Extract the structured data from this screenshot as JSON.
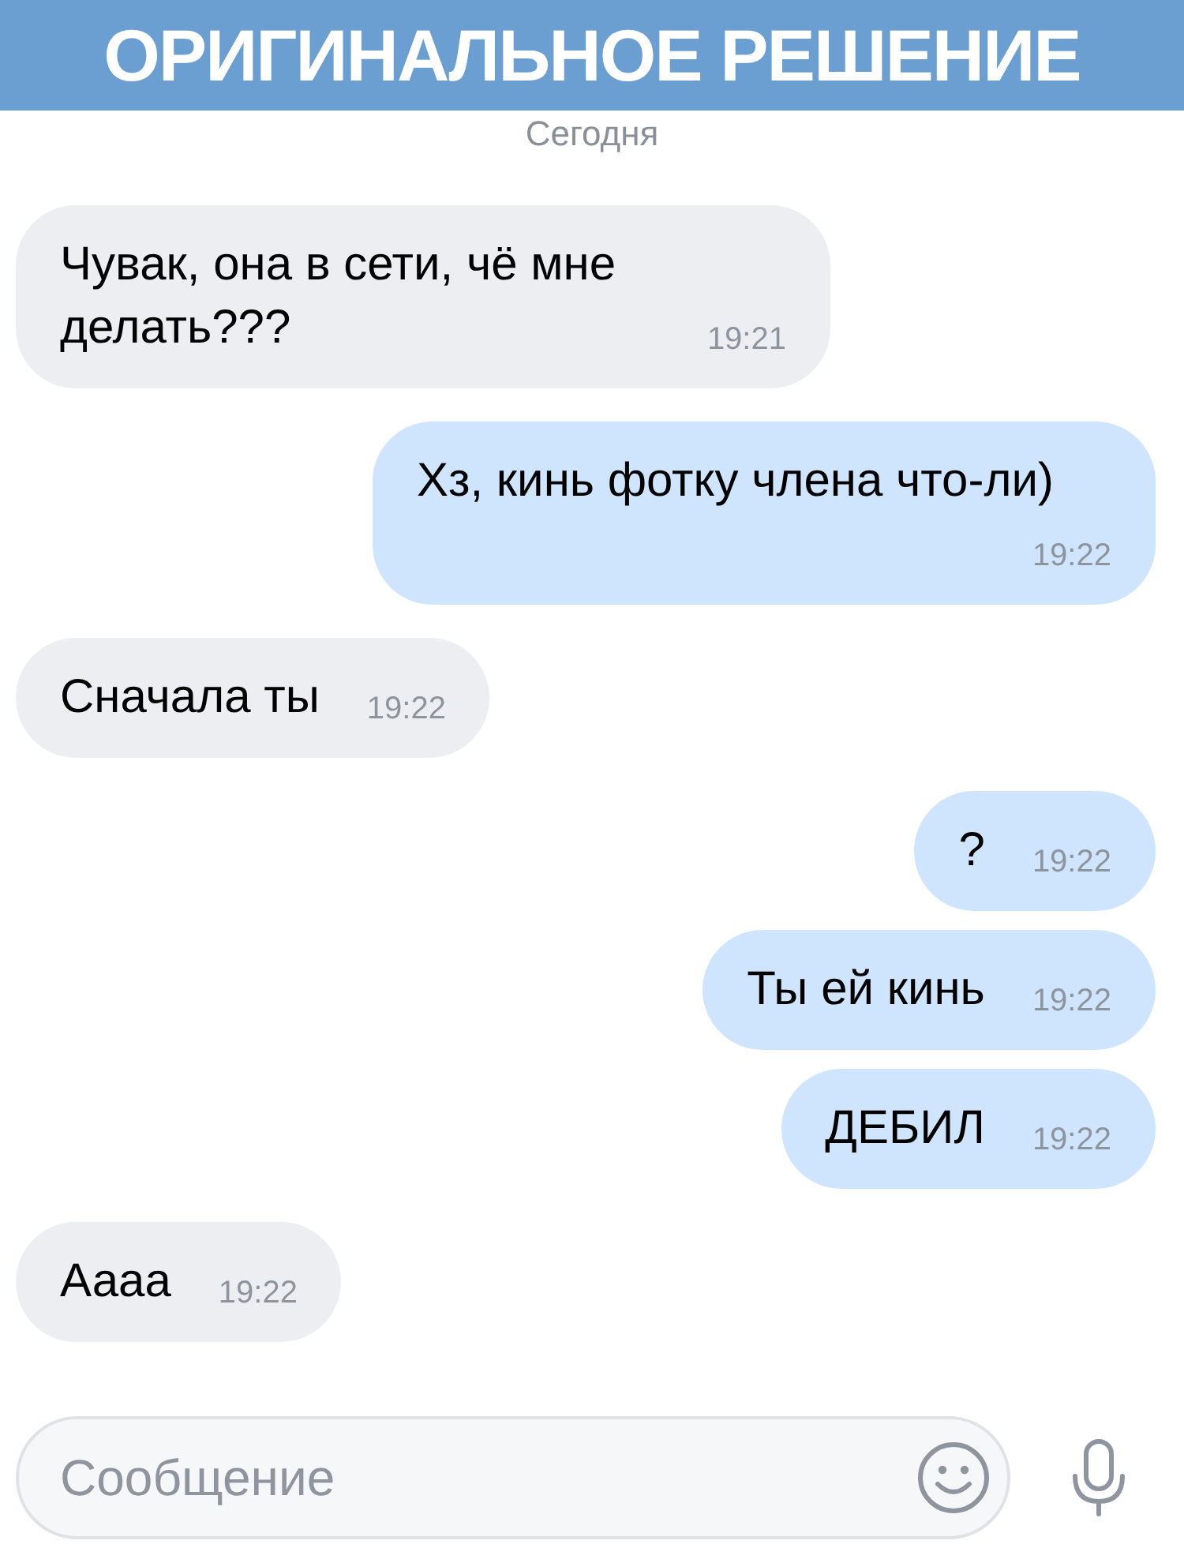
{
  "banner": {
    "title": "ОРИГИНАЛЬНОЕ РЕШЕНИЕ"
  },
  "date_label": "Сегодня",
  "messages": [
    {
      "kind": "incoming",
      "text": "Чувак, она в сети, чё мне делать???",
      "time": "19:21"
    },
    {
      "kind": "outgoing",
      "text": "Хз, кинь фотку члена что-ли)",
      "time": "19:22"
    },
    {
      "kind": "incoming",
      "text": "Сначала ты",
      "time": "19:22"
    },
    {
      "kind": "outgoing",
      "text": "?",
      "time": "19:22"
    },
    {
      "kind": "outgoing",
      "text": "Ты ей кинь",
      "time": "19:22"
    },
    {
      "kind": "outgoing",
      "text": "ДЕБИЛ",
      "time": "19:22"
    },
    {
      "kind": "incoming",
      "text": "Аааа",
      "time": "19:22"
    }
  ],
  "composer": {
    "placeholder": "Сообщение"
  }
}
